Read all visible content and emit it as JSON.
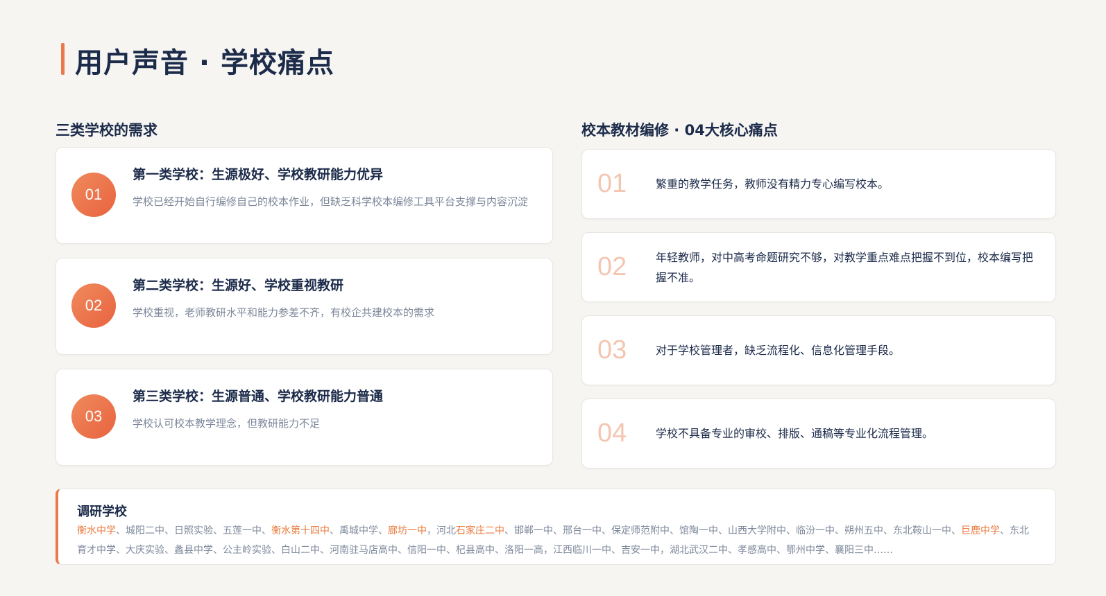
{
  "page": {
    "title": "用户声音 · 学校痛点",
    "accent_color": "#ea7a4c"
  },
  "left": {
    "heading": "三类学校的需求",
    "schools": [
      {
        "badge": "01",
        "title": "第一类学校：生源极好、学校教研能力优异",
        "desc": "学校已经开始自行编修自己的校本作业，但缺乏科学校本编修工具平台支撑与内容沉淀"
      },
      {
        "badge": "02",
        "title": "第二类学校：生源好、学校重视教研",
        "desc": "学校重视，老师教研水平和能力参差不齐，有校企共建校本的需求"
      },
      {
        "badge": "03",
        "title": "第三类学校：生源普通、学校教研能力普通",
        "desc": "学校认可校本教学理念，但教研能力不足"
      }
    ]
  },
  "right": {
    "heading": "校本教材编修 · 04大核心痛点",
    "pains": [
      {
        "num": "01",
        "text": "繁重的教学任务，教师没有精力专心编写校本。"
      },
      {
        "num": "02",
        "text": "年轻教师，对中高考命题研究不够，对教学重点难点把握不到位，校本编写把握不准。"
      },
      {
        "num": "03",
        "text": "对于学校管理者，缺乏流程化、信息化管理手段。"
      },
      {
        "num": "04",
        "text": "学校不具备专业的审校、排版、通稿等专业化流程管理。"
      }
    ]
  },
  "research": {
    "title": "调研学校",
    "segments": [
      {
        "text": "衡水中学",
        "hl": true
      },
      {
        "text": "、城阳二中、日照实验、五莲一中、",
        "hl": false
      },
      {
        "text": "衡水第十四中",
        "hl": true
      },
      {
        "text": "、禹城中学、",
        "hl": false
      },
      {
        "text": "廊坊一中",
        "hl": true
      },
      {
        "text": "，河北",
        "hl": false
      },
      {
        "text": "石家庄二中",
        "hl": true
      },
      {
        "text": "、邯郸一中、邢台一中、保定师范附中、馆陶一中、山西大学附中、临汾一中、朔州五中、东北鞍山一中、",
        "hl": false
      },
      {
        "text": "巨鹿中学",
        "hl": true
      },
      {
        "text": "、东北育才中学、大庆实验、蠡县中学、公主岭实验、白山二中、河南驻马店高中、信阳一中、杞县高中、洛阳一高，江西临川一中、吉安一中，湖北武汉二中、孝感高中、鄂州中学、襄阳三中……",
        "hl": false
      }
    ],
    "highlight_color": "#ea7a3c"
  }
}
